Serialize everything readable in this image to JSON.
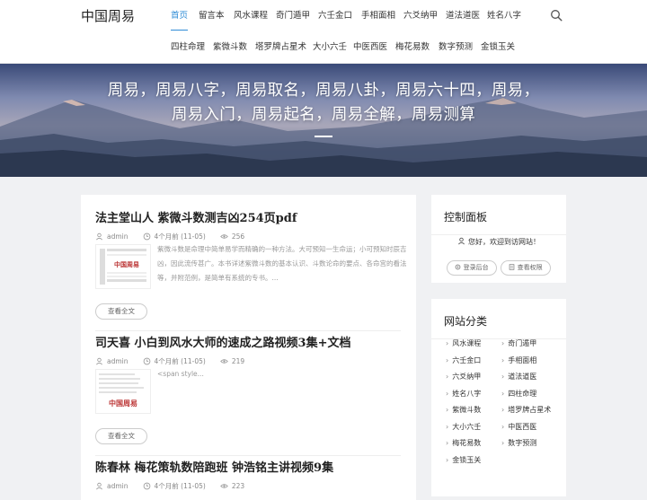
{
  "header": {
    "logo": "中国周易",
    "nav_row1": [
      "首页",
      "留言本",
      "风水课程",
      "奇门遁甲",
      "六壬金口",
      "手相面相",
      "六爻纳甲",
      "道法道医",
      "姓名八字"
    ],
    "nav_row2": [
      "四柱命理",
      "紫微斗数",
      "塔罗牌占星术",
      "大小六壬",
      "中医西医",
      "梅花易数",
      "数字预测",
      "金锁玉关"
    ],
    "active_index": 0
  },
  "banner": {
    "line1": "周易，周易八字，周易取名，周易八卦，周易六十四，周易，",
    "line2": "周易入门，周易起名，周易全解，周易测算"
  },
  "posts": [
    {
      "title": "法主堂山人 紫微斗数测吉凶254页pdf",
      "author": "admin",
      "date": "4个月前 (11-05)",
      "views": "256",
      "excerpt": "紫微斗数是命理中简单易学而精确的一种方法。大可预知一生命运；小可预知时辰吉凶，因此流传甚广。本书详述紫微斗数的基本认识、斗数论命的要点、各命宫的看法等，并附范例，是简单有系统的专书。...",
      "read_more": "查看全文",
      "thumb_logo": "中国周易"
    },
    {
      "title": "司天喜 小白到风水大师的速成之路视频3集+文档",
      "author": "admin",
      "date": "4个月前 (11-05)",
      "views": "219",
      "excerpt": "<span style...",
      "read_more": "查看全文",
      "thumb_logo": "中国周易"
    },
    {
      "title": "陈春林 梅花策轨数陪跑班 钟浩铭主讲视频9集",
      "author": "admin",
      "date": "4个月前 (11-05)",
      "views": "223"
    }
  ],
  "control_panel": {
    "title": "控制面板",
    "welcome": "您好，欢迎到访网站！",
    "login": "登录后台",
    "permission": "查看权限"
  },
  "categories": {
    "title": "网站分类",
    "items": [
      "风水课程",
      "奇门遁甲",
      "六壬金口",
      "手相面相",
      "六爻纳甲",
      "道法道医",
      "姓名八字",
      "四柱命理",
      "紫微斗数",
      "塔罗牌占星术",
      "大小六壬",
      "中医西医",
      "梅花易数",
      "数字预测",
      "金锁玉关"
    ]
  }
}
